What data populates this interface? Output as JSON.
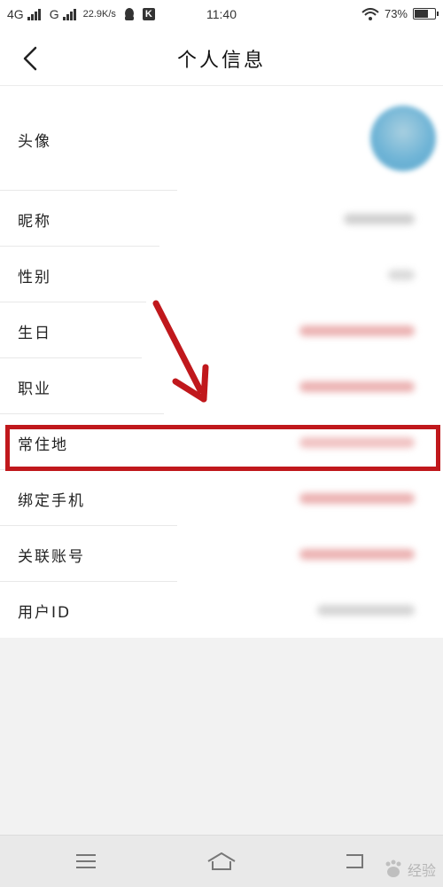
{
  "status_bar": {
    "network_1": "4G",
    "network_2": "G",
    "net_speed": "22.9K/s",
    "time": "11:40",
    "battery_percent": 73,
    "battery_label": "73%"
  },
  "header": {
    "title": "个人信息"
  },
  "profile_rows": [
    {
      "label": "头像"
    },
    {
      "label": "昵称"
    },
    {
      "label": "性别"
    },
    {
      "label": "生日"
    },
    {
      "label": "职业"
    },
    {
      "label": "常住地"
    },
    {
      "label": "绑定手机"
    },
    {
      "label": "关联账号"
    },
    {
      "label": "用户ID"
    }
  ],
  "colors": {
    "highlight": "#c0181c",
    "blurred_value_gray": "#bfbfbf",
    "blurred_value_red": "#e59a9a",
    "avatar": "#6fb4d6"
  },
  "watermark": {
    "text": "经验"
  }
}
